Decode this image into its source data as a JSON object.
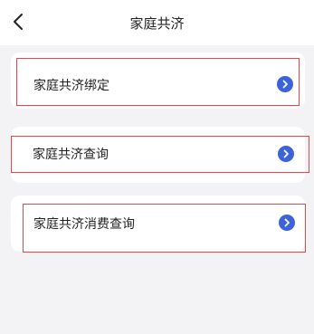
{
  "header": {
    "title": "家庭共济",
    "back_icon": "chevron-left-icon"
  },
  "menu": {
    "items": [
      {
        "label": "家庭共济绑定",
        "icon": "chevron-right-circle-icon"
      },
      {
        "label": "家庭共济查询",
        "icon": "chevron-right-circle-icon"
      },
      {
        "label": "家庭共济消费查询",
        "icon": "chevron-right-circle-icon"
      }
    ]
  },
  "colors": {
    "accent": "#3d63db",
    "highlight_border": "#e0484d",
    "background": "#f3f3f5"
  }
}
